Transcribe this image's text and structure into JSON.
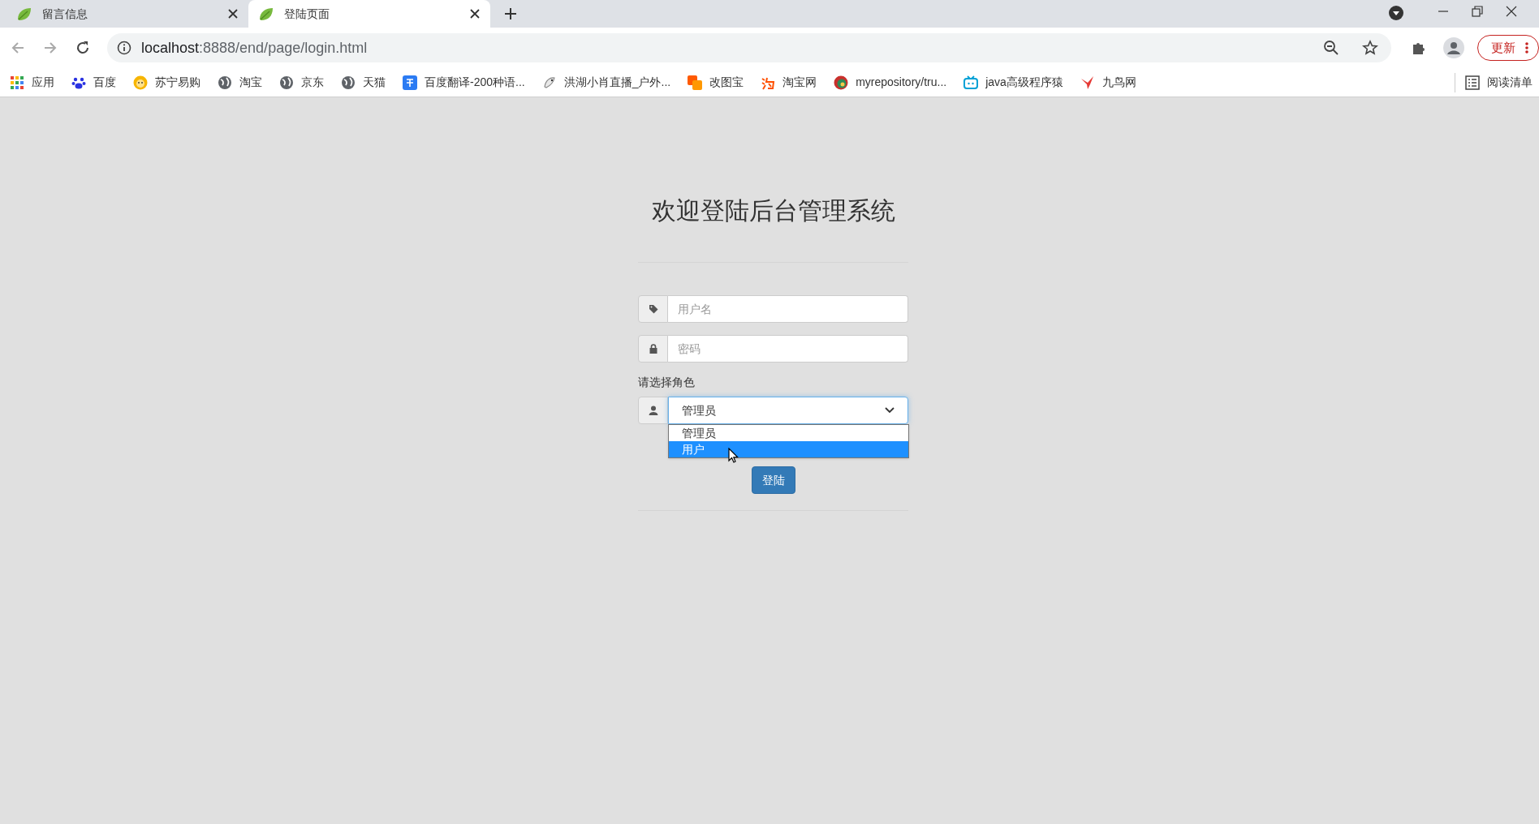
{
  "tabs": [
    {
      "title": "留言信息",
      "selected": false
    },
    {
      "title": "登陆页面",
      "selected": true
    }
  ],
  "address_bar": {
    "url_host": "localhost",
    "url_rest": ":8888/end/page/login.html"
  },
  "update_button": "更新",
  "bookmarks": [
    {
      "label": "应用",
      "kind": "apps"
    },
    {
      "label": "百度",
      "kind": "paw"
    },
    {
      "label": "苏宁易购",
      "kind": "lion"
    },
    {
      "label": "淘宝",
      "kind": "globe"
    },
    {
      "label": "京东",
      "kind": "globe"
    },
    {
      "label": "天猫",
      "kind": "globe"
    },
    {
      "label": "百度翻译-200种语...",
      "kind": "translate"
    },
    {
      "label": "洪湖小肖直播_户外...",
      "kind": "bird"
    },
    {
      "label": "改图宝",
      "kind": "squares"
    },
    {
      "label": "淘宝网",
      "kind": "tao"
    },
    {
      "label": "myrepository/tru...",
      "kind": "ring"
    },
    {
      "label": "java高级程序猿",
      "kind": "tv"
    },
    {
      "label": "九鸟网",
      "kind": "crane"
    }
  ],
  "reading_list": "阅读清单",
  "login": {
    "title": "欢迎登陆后台管理系统",
    "username": {
      "placeholder": "用户名"
    },
    "password": {
      "placeholder": "密码"
    },
    "role_label": "请选择角色",
    "role_select": {
      "value": "管理员",
      "expanded": true,
      "options": [
        {
          "label": "管理员",
          "highlighted": false
        },
        {
          "label": "用户",
          "highlighted": true
        }
      ]
    },
    "submit": "登陆"
  }
}
